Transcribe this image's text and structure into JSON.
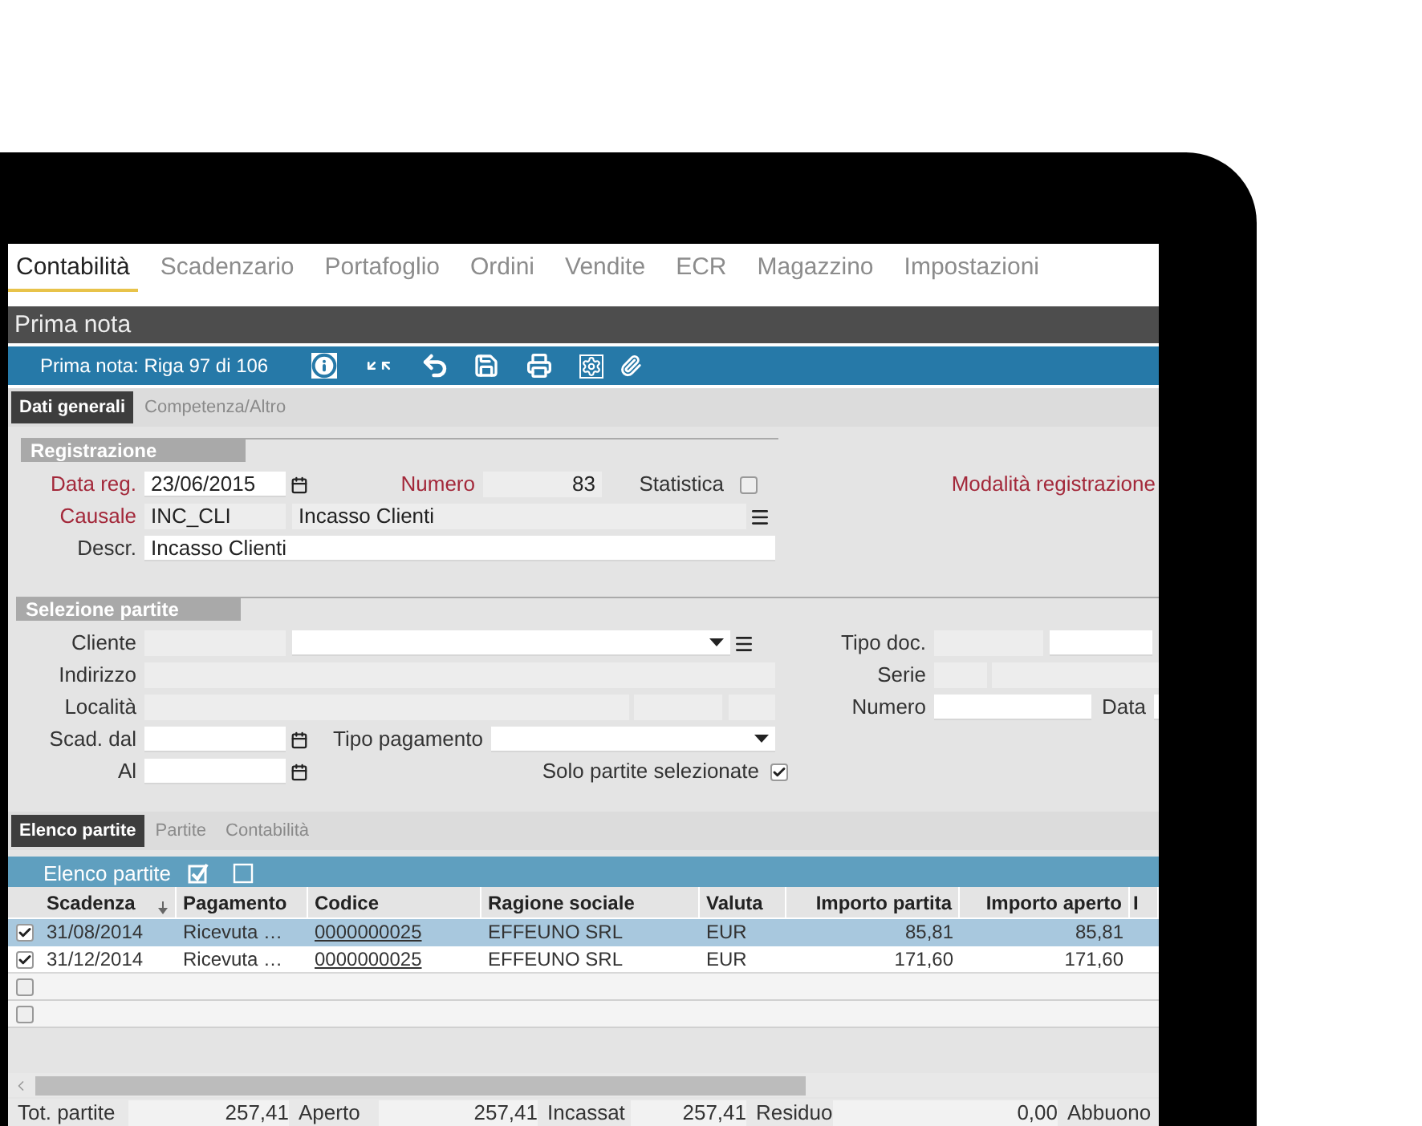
{
  "nav_tabs": [
    {
      "label": "Contabilità",
      "selected": true
    },
    {
      "label": "Scadenzario",
      "selected": false
    },
    {
      "label": "Portafoglio",
      "selected": false
    },
    {
      "label": "Ordini",
      "selected": false
    },
    {
      "label": "Vendite",
      "selected": false
    },
    {
      "label": "ECR",
      "selected": false
    },
    {
      "label": "Magazzino",
      "selected": false
    },
    {
      "label": "Impostazioni",
      "selected": false
    }
  ],
  "panel_title": "Prima nota",
  "toolbar": {
    "title": "Prima nota: Riga 97 di 106"
  },
  "form_tabs": [
    {
      "label": "Dati generali",
      "selected": true
    },
    {
      "label": "Competenza/Altro",
      "selected": false
    }
  ],
  "registrazione": {
    "title": "Registrazione",
    "data_reg": {
      "label": "Data reg.",
      "required": true,
      "field": {
        "kind": "date",
        "editable": true,
        "value": "23/06/2015"
      }
    },
    "numero": {
      "label": "Numero",
      "required": true,
      "field": {
        "kind": "text",
        "editable": false,
        "value": "83"
      }
    },
    "statistica": {
      "label": "Statistica",
      "checked": false
    },
    "modalita": {
      "label": "Modalità registrazione",
      "required": true
    },
    "causale": {
      "label": "Causale",
      "required": true,
      "fields": [
        {
          "kind": "text",
          "editable": false,
          "value": "INC_CLI"
        },
        {
          "kind": "menu",
          "editable": false,
          "value": "Incasso Clienti"
        }
      ]
    },
    "descr": {
      "label": "Descr.",
      "required": false,
      "field": {
        "kind": "text",
        "editable": true,
        "value": "Incasso Clienti"
      }
    }
  },
  "selezione": {
    "title": "Selezione partite",
    "cliente": {
      "label": "Cliente",
      "fields": [
        {
          "kind": "text",
          "editable": false
        },
        {
          "kind": "lookup",
          "editable": true
        }
      ]
    },
    "indirizzo": {
      "label": "Indirizzo",
      "fields": [
        {
          "kind": "text",
          "editable": false
        }
      ]
    },
    "localita": {
      "label": "Località",
      "fields": [
        {
          "kind": "text",
          "editable": false
        },
        {
          "kind": "text",
          "editable": false
        },
        {
          "kind": "text",
          "editable": false
        }
      ]
    },
    "scad_dal": {
      "label": "Scad. dal",
      "fields": [
        {
          "kind": "date",
          "editable": true
        }
      ]
    },
    "tipo_pagamento": {
      "label": "Tipo pagamento",
      "fields": [
        {
          "kind": "select",
          "editable": true
        }
      ]
    },
    "al": {
      "label": "Al",
      "fields": [
        {
          "kind": "date",
          "editable": true
        }
      ]
    },
    "solo_selezionate": {
      "label": "Solo partite selezionate",
      "checked": true
    },
    "tipo_doc": {
      "label": "Tipo doc.",
      "fields": [
        {
          "kind": "text",
          "editable": false
        },
        {
          "kind": "text",
          "editable": true
        }
      ]
    },
    "serie": {
      "label": "Serie",
      "fields": [
        {
          "kind": "text",
          "editable": false
        },
        {
          "kind": "text",
          "editable": false
        }
      ]
    },
    "numero": {
      "label": "Numero",
      "fields": [
        {
          "kind": "text",
          "editable": true
        }
      ]
    },
    "data": {
      "label": "Data",
      "fields": [
        {
          "kind": "text",
          "editable": true
        }
      ]
    }
  },
  "list_tabs": [
    {
      "label": "Elenco partite",
      "selected": true
    },
    {
      "label": "Partite",
      "selected": false
    },
    {
      "label": "Contabilità",
      "selected": false
    }
  ],
  "grid": {
    "title": "Elenco partite",
    "columns": [
      {
        "label": "Scadenza",
        "kind": "date",
        "sorted": true
      },
      {
        "label": "Pagamento",
        "kind": "text",
        "sorted": false
      },
      {
        "label": "Codice",
        "kind": "link",
        "sorted": false
      },
      {
        "label": "Ragione sociale",
        "kind": "text",
        "sorted": false
      },
      {
        "label": "Valuta",
        "kind": "text",
        "sorted": false
      },
      {
        "label": "Importo partita",
        "kind": "amount",
        "sorted": false
      },
      {
        "label": "Importo aperto",
        "kind": "amount",
        "sorted": false
      },
      {
        "label": "I",
        "kind": "text",
        "sorted": false
      }
    ],
    "rows": [
      {
        "checked": true,
        "selected": true,
        "cells": [
          "31/08/2014",
          "Ricevuta …",
          "0000000025",
          "EFFEUNO SRL",
          "EUR",
          "85,81",
          "85,81"
        ]
      },
      {
        "checked": true,
        "selected": false,
        "cells": [
          "31/12/2014",
          "Ricevuta …",
          "0000000025",
          "EFFEUNO SRL",
          "EUR",
          "171,60",
          "171,60"
        ]
      },
      {
        "checked": false,
        "selected": false
      },
      {
        "checked": false,
        "selected": false
      }
    ]
  },
  "totals": [
    {
      "label": "Tot. partite",
      "value": "257,41"
    },
    {
      "label": "Aperto",
      "value": "257,41"
    },
    {
      "label": "Incassat",
      "value": "257,41"
    },
    {
      "label": "Residuo",
      "value": "0,00"
    },
    {
      "label": "Abbuono"
    }
  ]
}
